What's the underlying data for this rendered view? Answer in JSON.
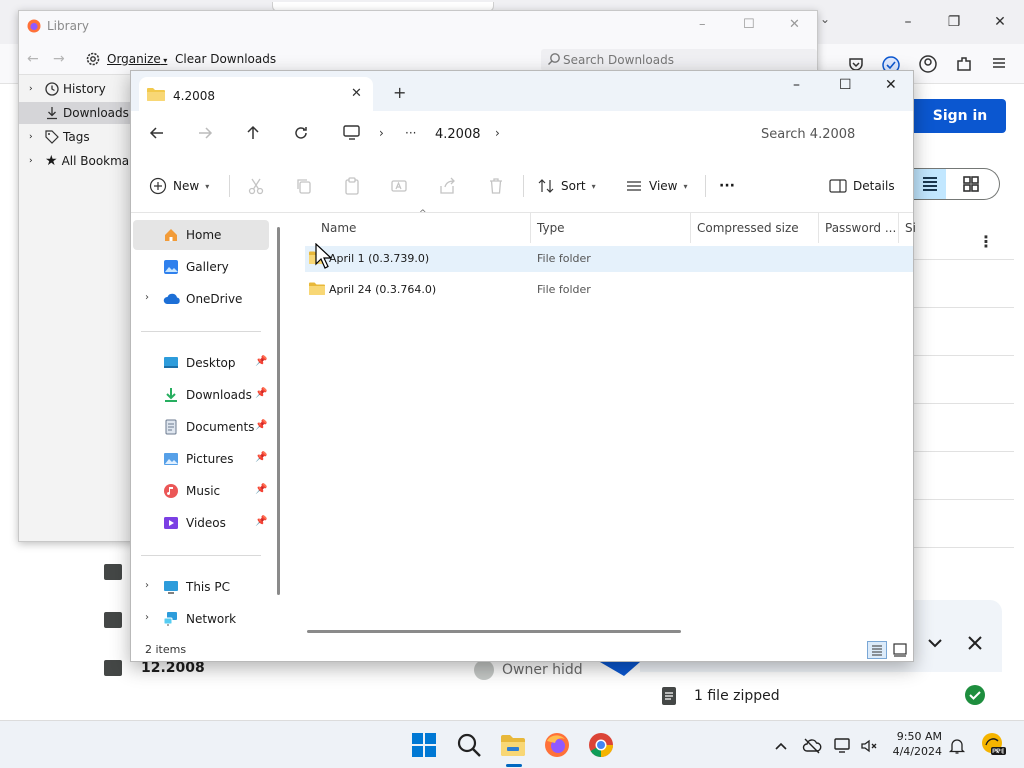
{
  "library": {
    "title": "Library",
    "organize": "Organize",
    "clear": "Clear Downloads",
    "search_placeholder": "Search Downloads",
    "nav": [
      {
        "label": "History"
      },
      {
        "label": "Downloads"
      },
      {
        "label": "Tags"
      },
      {
        "label": "All Bookmarks"
      }
    ]
  },
  "browser": {
    "signin": "Sign in",
    "rows": [
      "12.2008"
    ],
    "owner": "Owner hidd",
    "toast": "1 file zipped"
  },
  "explorer": {
    "tab_title": "4.2008",
    "breadcrumb_ellipsis": "···",
    "breadcrumb_current": "4.2008",
    "search_placeholder": "Search 4.2008",
    "cmd": {
      "new": "New",
      "sort": "Sort",
      "view": "View",
      "more": "···",
      "details": "Details"
    },
    "nav": {
      "home": "Home",
      "gallery": "Gallery",
      "onedrive": "OneDrive",
      "desktop": "Desktop",
      "downloads": "Downloads",
      "documents": "Documents",
      "pictures": "Pictures",
      "music": "Music",
      "videos": "Videos",
      "thispc": "This PC",
      "network": "Network"
    },
    "columns": [
      "Name",
      "Type",
      "Compressed size",
      "Password ...",
      "Si"
    ],
    "files": [
      {
        "name": "April 1 (0.3.739.0)",
        "type": "File folder"
      },
      {
        "name": "April 24 (0.3.764.0)",
        "type": "File folder"
      }
    ],
    "status": "2 items"
  },
  "taskbar": {
    "time": "9:50 AM",
    "date": "4/4/2024"
  },
  "colors": {
    "accent": "#0b57d0",
    "folder": "#f2c94c",
    "selection": "#e5f1fb"
  }
}
